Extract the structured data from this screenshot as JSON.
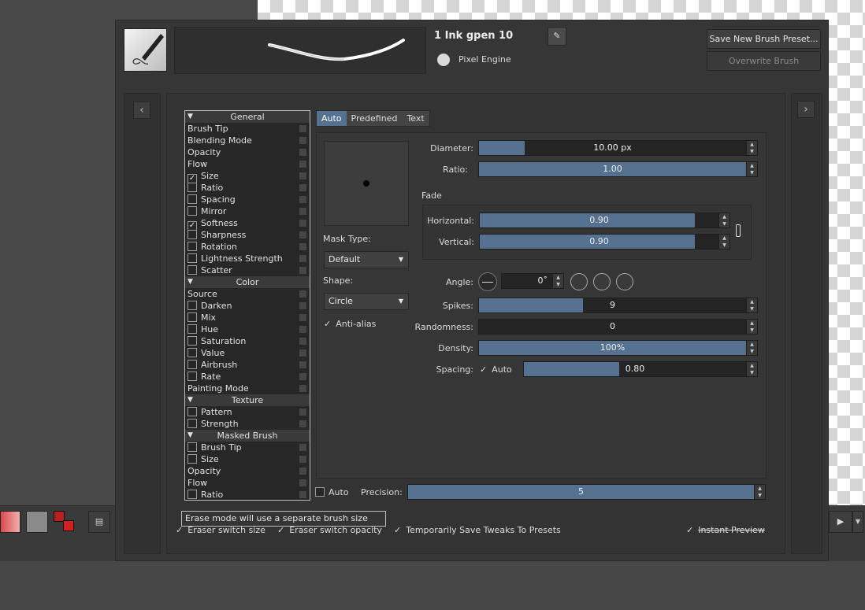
{
  "preset": {
    "name": "1 Ink gpen 10",
    "engine": "Pixel Engine",
    "save_new_label": "Save New Brush Preset...",
    "overwrite_label": "Overwrite Brush"
  },
  "options": {
    "general_label": "General",
    "brush_tip": "Brush Tip",
    "blending_mode": "Blending Mode",
    "opacity": "Opacity",
    "flow": "Flow",
    "size": "Size",
    "ratio": "Ratio",
    "spacing": "Spacing",
    "mirror": "Mirror",
    "softness": "Softness",
    "sharpness": "Sharpness",
    "rotation": "Rotation",
    "lightness": "Lightness Strength",
    "scatter": "Scatter",
    "color_label": "Color",
    "source": "Source",
    "darken": "Darken",
    "mix": "Mix",
    "hue": "Hue",
    "saturation": "Saturation",
    "value": "Value",
    "airbrush": "Airbrush",
    "rate": "Rate",
    "painting_mode": "Painting Mode",
    "texture_label": "Texture",
    "pattern": "Pattern",
    "strength": "Strength",
    "masked_label": "Masked Brush",
    "m_brush_tip": "Brush Tip",
    "m_size": "Size",
    "m_opacity": "Opacity",
    "m_flow": "Flow",
    "m_ratio": "Ratio"
  },
  "tabs": {
    "auto": "Auto",
    "predefined": "Predefined",
    "text": "Text"
  },
  "tip": {
    "mask_type_label": "Mask Type:",
    "mask_type_value": "Default",
    "shape_label": "Shape:",
    "shape_value": "Circle",
    "antialias_label": "Anti-alias"
  },
  "params": {
    "diameter_label": "Diameter:",
    "diameter_value": "10.00 px",
    "diameter_fill": 0.17,
    "ratio_label": "Ratio:",
    "ratio_value": "1.00",
    "ratio_fill": 1.0,
    "fade_label": "Fade",
    "horizontal_label": "Horizontal:",
    "horizontal_value": "0.90",
    "horizontal_fill": 0.9,
    "vertical_label": "Vertical:",
    "vertical_value": "0.90",
    "vertical_fill": 0.9,
    "angle_label": "Angle:",
    "angle_value": "0˚",
    "spikes_label": "Spikes:",
    "spikes_value": "9",
    "spikes_fill": 0.39,
    "randomness_label": "Randomness:",
    "randomness_value": "0",
    "randomness_fill": 0.0,
    "density_label": "Density:",
    "density_value": "100%",
    "density_fill": 1.0,
    "spacing_label": "Spacing:",
    "spacing_auto_label": "Auto",
    "spacing_value": "0.80",
    "spacing_fill": 0.43
  },
  "precision": {
    "auto_label": "Auto",
    "label": "Precision:",
    "value": "5",
    "fill": 1.0
  },
  "footer": {
    "tooltip": "Erase mode will use a separate brush size",
    "eraser_size": "Eraser switch size",
    "eraser_opacity": "Eraser switch opacity",
    "save_tweaks": "Temporarily Save Tweaks To Presets",
    "instant_preview": "Instant Preview"
  },
  "colors": {
    "accent": "#56708f",
    "panel": "#363636"
  }
}
